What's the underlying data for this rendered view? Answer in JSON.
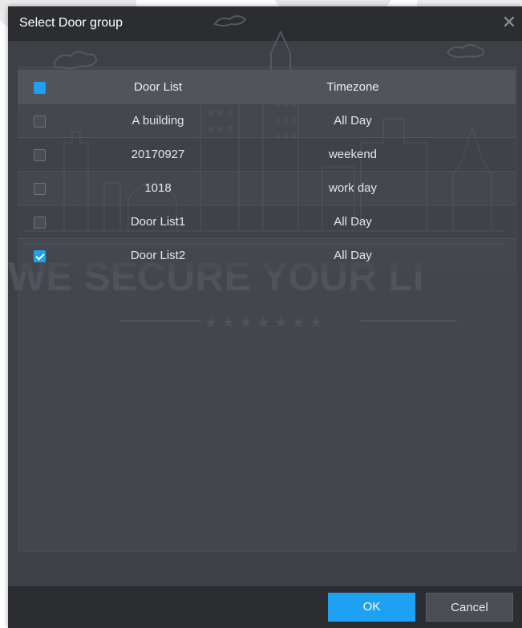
{
  "dialog": {
    "title": "Select Door group",
    "close_icon": "close-icon",
    "ok_label": "OK",
    "cancel_label": "Cancel",
    "accent_color": "#1ea1f2"
  },
  "table": {
    "headers": {
      "door": "Door List",
      "timezone": "Timezone"
    },
    "header_check_state": "partial",
    "rows": [
      {
        "door": "A building",
        "timezone": "All Day",
        "checked": false
      },
      {
        "door": "20170927",
        "timezone": "weekend",
        "checked": false
      },
      {
        "door": "1018",
        "timezone": "work day",
        "checked": false
      },
      {
        "door": "Door List1",
        "timezone": "All Day",
        "checked": false
      },
      {
        "door": "Door List2",
        "timezone": "All Day",
        "checked": true
      }
    ]
  },
  "watermark": {
    "text": "WE SECURE YOUR LI",
    "stars": "★ ★ ★ ★ ★ ★ ★"
  }
}
